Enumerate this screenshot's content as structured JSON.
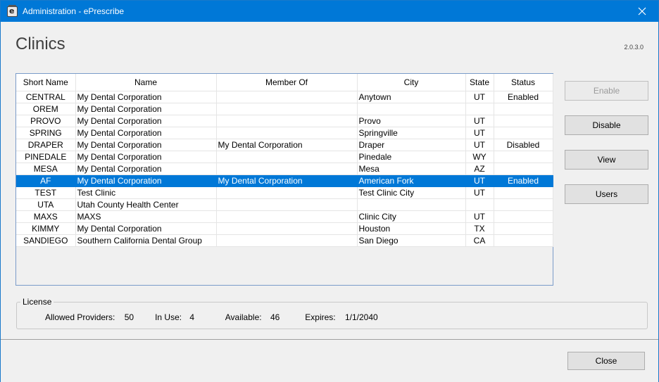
{
  "window": {
    "title": "Administration - ePrescribe",
    "app_icon_letter": "e"
  },
  "page": {
    "title": "Clinics",
    "version": "2.0.3.0"
  },
  "grid": {
    "columns": [
      "Short Name",
      "Name",
      "Member Of",
      "City",
      "State",
      "Status"
    ],
    "rows": [
      {
        "short": "CENTRAL",
        "name": "My Dental Corporation",
        "member": "",
        "city": "Anytown",
        "state": "UT",
        "status": "Enabled"
      },
      {
        "short": "OREM",
        "name": "My Dental Corporation",
        "member": "",
        "city": "",
        "state": "",
        "status": ""
      },
      {
        "short": "PROVO",
        "name": "My Dental Corporation",
        "member": "",
        "city": "Provo",
        "state": "UT",
        "status": ""
      },
      {
        "short": "SPRING",
        "name": "My Dental Corporation",
        "member": "",
        "city": "Springville",
        "state": "UT",
        "status": ""
      },
      {
        "short": "DRAPER",
        "name": "My Dental Corporation",
        "member": "My Dental Corporation",
        "city": "Draper",
        "state": "UT",
        "status": "Disabled"
      },
      {
        "short": "PINEDALE",
        "name": "My Dental Corporation",
        "member": "",
        "city": "Pinedale",
        "state": "WY",
        "status": ""
      },
      {
        "short": "MESA",
        "name": "My Dental Corporation",
        "member": "",
        "city": "Mesa",
        "state": "AZ",
        "status": ""
      },
      {
        "short": "AF",
        "name": "My Dental Corporation",
        "member": "My Dental Corporation",
        "city": "American Fork",
        "state": "UT",
        "status": "Enabled"
      },
      {
        "short": "TEST",
        "name": "Test Clinic",
        "member": "",
        "city": "Test Clinic City",
        "state": "UT",
        "status": ""
      },
      {
        "short": "UTA",
        "name": "Utah County Health Center",
        "member": "",
        "city": "",
        "state": "",
        "status": ""
      },
      {
        "short": "MAXS",
        "name": "MAXS",
        "member": "",
        "city": "Clinic City",
        "state": "UT",
        "status": ""
      },
      {
        "short": "KIMMY",
        "name": "My Dental Corporation",
        "member": "",
        "city": "Houston",
        "state": "TX",
        "status": ""
      },
      {
        "short": "SANDIEGO",
        "name": "Southern California Dental Group",
        "member": "",
        "city": "San Diego",
        "state": "CA",
        "status": ""
      }
    ],
    "selected_short_name": "AF"
  },
  "actions": {
    "enable": "Enable",
    "disable": "Disable",
    "view": "View",
    "users": "Users"
  },
  "license": {
    "legend": "License",
    "allowed_label": "Allowed Providers:",
    "allowed": "50",
    "in_use_label": "In Use:",
    "in_use": "4",
    "available_label": "Available:",
    "available": "46",
    "expires_label": "Expires:",
    "expires": "1/1/2040"
  },
  "footer": {
    "close": "Close"
  },
  "colors": {
    "titlebar": "#0078d7",
    "selection": "#0078d7"
  }
}
